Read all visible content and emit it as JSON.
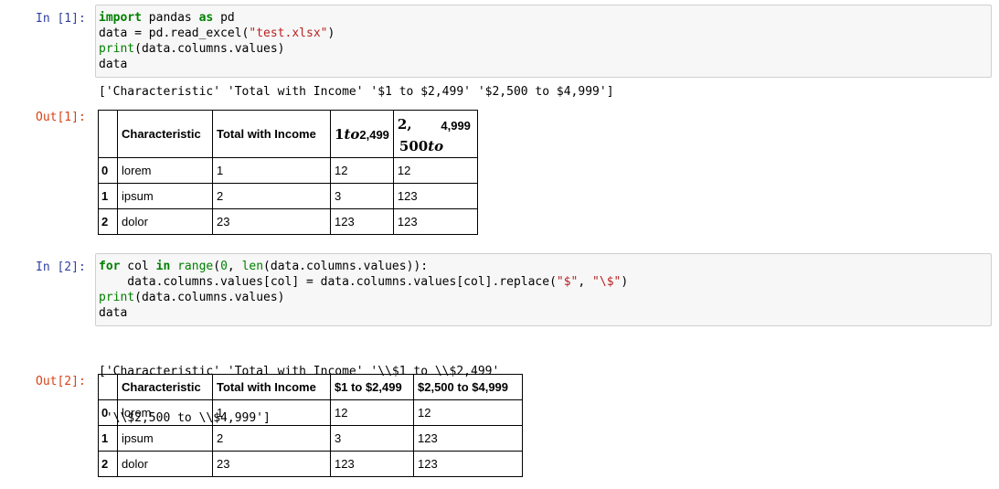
{
  "cells": [
    {
      "in_prompt": "In [1]:",
      "code": [
        "import pandas as pd",
        "data = pd.read_excel(\"test.xlsx\")",
        "print(data.columns.values)",
        "data"
      ],
      "stdout": [
        "['Characteristic' 'Total with Income' '$1 to $2,499' '$2,500 to $4,999']"
      ],
      "out_prompt": "Out[1]:",
      "table": {
        "headers": [
          "Characteristic",
          "Total with Income"
        ],
        "math_header_1": {
          "a": "1",
          "b": "to",
          "c": "2,499"
        },
        "math_header_2": {
          "a": "2,",
          "b": "4,999",
          "c": "500",
          "d": "to"
        },
        "rows": [
          {
            "index": "0",
            "cells": [
              "lorem",
              "1",
              "12",
              "12"
            ]
          },
          {
            "index": "1",
            "cells": [
              "ipsum",
              "2",
              "3",
              "123"
            ]
          },
          {
            "index": "2",
            "cells": [
              "dolor",
              "23",
              "123",
              "123"
            ]
          }
        ]
      }
    },
    {
      "in_prompt": "In [2]:",
      "code": [
        "for col in range(0, len(data.columns.values)):",
        "    data.columns.values[col] = data.columns.values[col].replace(\"$\", \"\\$\")",
        "print(data.columns.values)",
        "data"
      ],
      "stdout": [
        "['Characteristic' 'Total with Income' '\\\\$1 to \\\\$2,499'",
        " '\\\\$2,500 to \\\\$4,999']"
      ],
      "out_prompt": "Out[2]:",
      "table": {
        "headers": [
          "Characteristic",
          "Total with Income",
          "$1 to $2,499",
          "$2,500 to $4,999"
        ],
        "rows": [
          {
            "index": "0",
            "cells": [
              "lorem",
              "1",
              "12",
              "12"
            ]
          },
          {
            "index": "1",
            "cells": [
              "ipsum",
              "2",
              "3",
              "123"
            ]
          },
          {
            "index": "2",
            "cells": [
              "dolor",
              "23",
              "123",
              "123"
            ]
          }
        ]
      }
    }
  ],
  "colors": {
    "in_prompt": "#303f9f",
    "out_prompt": "#d84315",
    "keyword": "#008000",
    "string": "#ba2121",
    "code_background": "#f7f7f7"
  }
}
